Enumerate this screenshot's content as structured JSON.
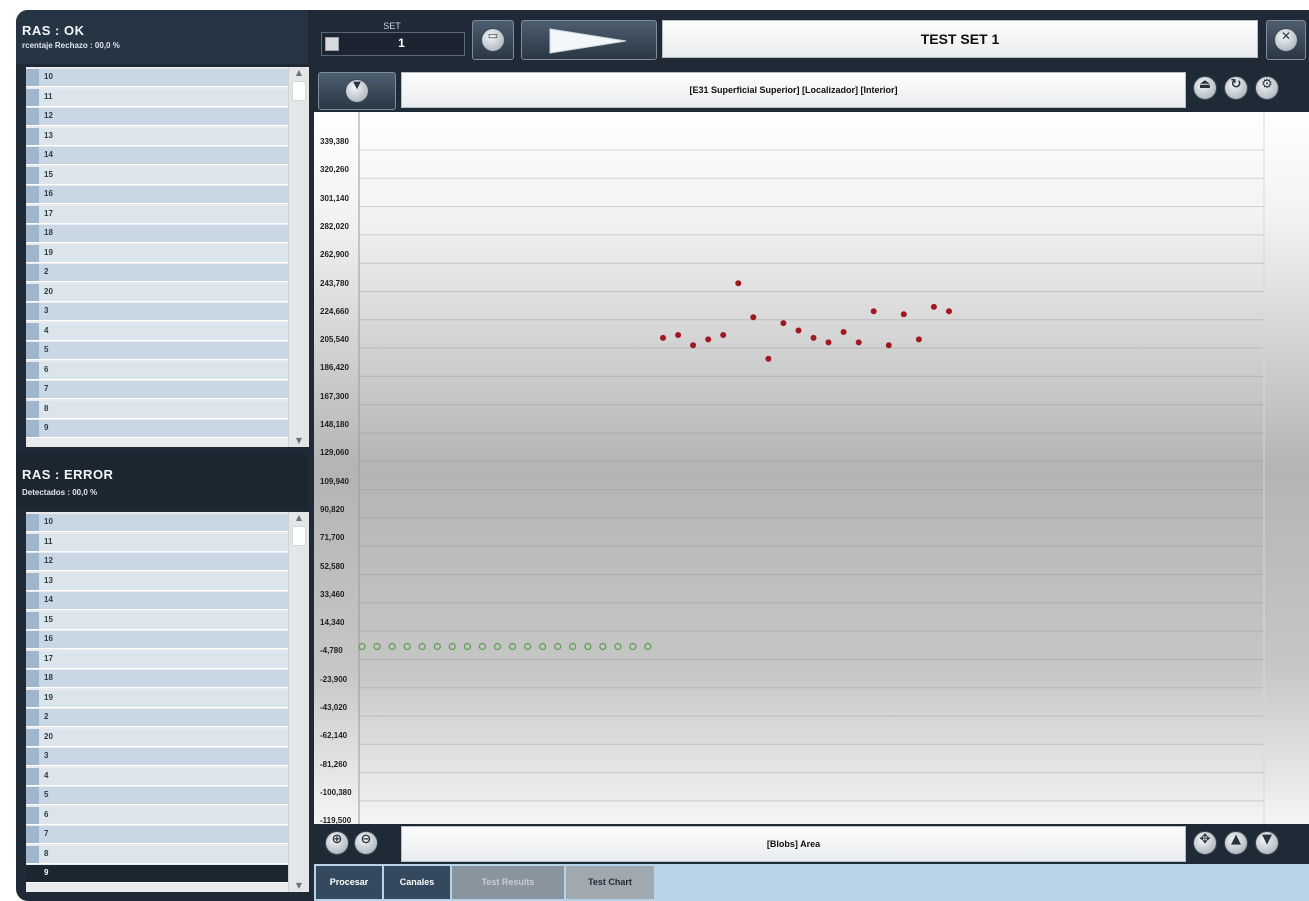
{
  "ok_panel": {
    "title": "RAS : OK",
    "subtitle": "rcentaje Rechazo : 00,0 %",
    "items": [
      "10",
      "11",
      "12",
      "13",
      "14",
      "15",
      "16",
      "17",
      "18",
      "19",
      "2",
      "20",
      "3",
      "4",
      "5",
      "6",
      "7",
      "8",
      "9"
    ]
  },
  "error_panel": {
    "title": "RAS : ERROR",
    "subtitle": "Detectados : 00,0 %",
    "items": [
      "10",
      "11",
      "12",
      "13",
      "14",
      "15",
      "16",
      "17",
      "18",
      "19",
      "2",
      "20",
      "3",
      "4",
      "5",
      "6",
      "7",
      "8",
      "9"
    ],
    "selected_item": "9"
  },
  "toolbar": {
    "set_label": "SET",
    "set_value": "1",
    "test_title": "TEST SET 1"
  },
  "chart_header": {
    "title": "[E31 Superficial Superior] [Localizador] [Interior]"
  },
  "chart_footer": {
    "title": "[Blobs] Area"
  },
  "tabs": [
    {
      "label": "Procesar",
      "enabled": true
    },
    {
      "label": "Canales",
      "enabled": true
    },
    {
      "label": "Test Results",
      "enabled": false
    },
    {
      "label": "Test Chart",
      "enabled": true
    }
  ],
  "icons": {
    "folder": "folder-icon",
    "play": "play-icon",
    "close": "close-icon",
    "dropdown": "chevron-down-icon",
    "eject": "eject-icon",
    "refresh": "refresh-icon",
    "settings": "settings-icon",
    "zoom_in": "zoom-in-icon",
    "zoom_out": "zoom-out-icon",
    "move": "move-icon",
    "up": "arrow-up-icon",
    "down": "arrow-down-icon"
  },
  "colors": {
    "error_point": "#a11822",
    "ok_point": "#5a9c4e",
    "selected_row": "#1c2630"
  },
  "chart_data": {
    "type": "scatter",
    "yticks": [
      "339,380",
      "320,260",
      "301,140",
      "282,020",
      "262,900",
      "243,780",
      "224,660",
      "205,540",
      "186,420",
      "167,300",
      "148,180",
      "129,060",
      "109,940",
      "90,820",
      "71,700",
      "52,580",
      "33,460",
      "14,340",
      "-4,780",
      "-23,900",
      "-43,020",
      "-62,140",
      "-81,260",
      "-100,380",
      "-119,500"
    ],
    "y_min": -119.5,
    "y_max": 339.38,
    "x_range": [
      0,
      60
    ],
    "series": [
      {
        "role": "error",
        "x": [
          20,
          21,
          22,
          23,
          24,
          25,
          26,
          27,
          28,
          29,
          30,
          31,
          32,
          33,
          34,
          35,
          36,
          37,
          38,
          39
        ],
        "y": [
          207,
          209,
          202,
          206,
          209,
          244,
          221,
          193,
          217,
          212,
          207,
          204,
          211,
          204,
          225,
          202,
          223,
          206,
          228,
          225
        ]
      },
      {
        "role": "ok",
        "x": [
          0,
          1,
          2,
          3,
          4,
          5,
          6,
          7,
          8,
          9,
          10,
          11,
          12,
          13,
          14,
          15,
          16,
          17,
          18,
          19
        ],
        "y": [
          -1.5,
          -1.5,
          -1.5,
          -1.5,
          -1.5,
          -1.5,
          -1.5,
          -1.5,
          -1.5,
          -1.5,
          -1.5,
          -1.5,
          -1.5,
          -1.5,
          -1.5,
          -1.5,
          -1.5,
          -1.5,
          -1.5,
          -1.5
        ]
      }
    ]
  }
}
